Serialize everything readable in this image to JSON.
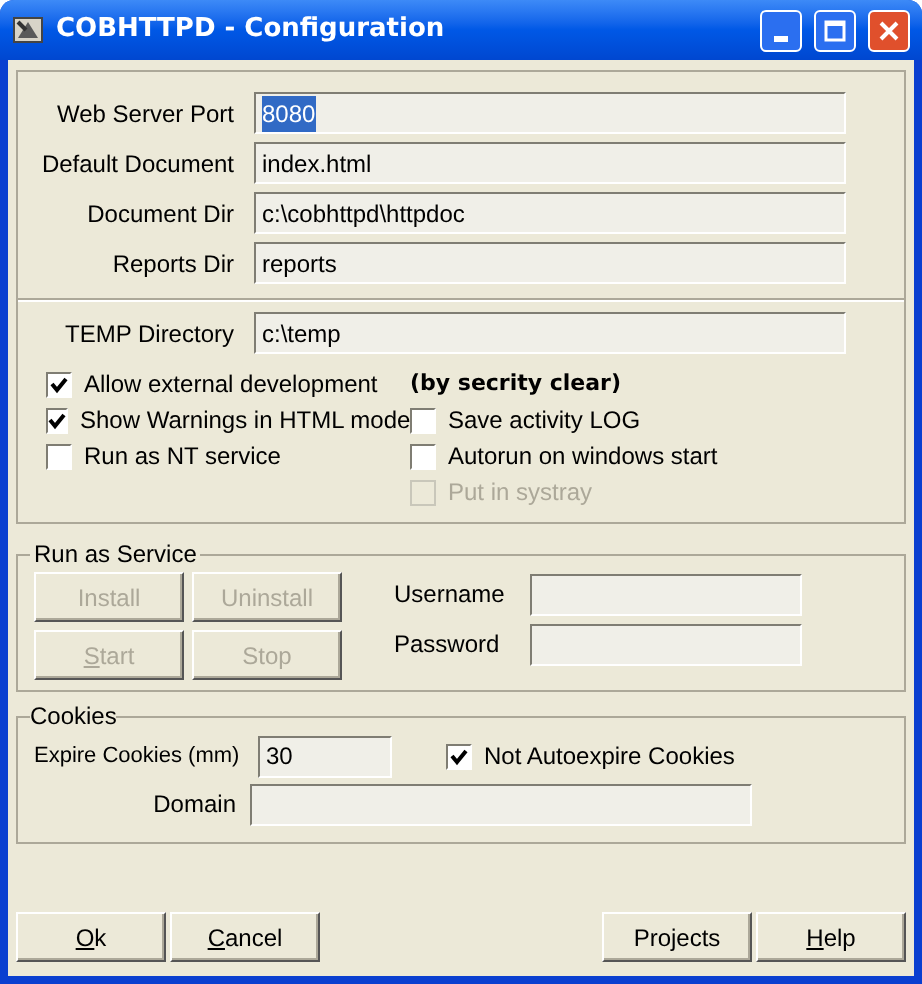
{
  "window": {
    "title": "COBHTTPD - Configuration"
  },
  "fields": [
    {
      "label": "Web Server Port",
      "value": "8080",
      "highlighted": true
    },
    {
      "label": "Default Document",
      "value": "index.html",
      "highlighted": false
    },
    {
      "label": "Document Dir",
      "value": "c:\\cobhttpd\\httpdoc",
      "highlighted": false
    },
    {
      "label": "Reports Dir",
      "value": "reports",
      "highlighted": false
    }
  ],
  "temp": {
    "label": "TEMP Directory",
    "value": "c:\\temp"
  },
  "options_left": [
    {
      "label": "Allow external  development",
      "checked": true,
      "disabled": false
    },
    {
      "label": "Show Warnings in HTML mode",
      "checked": true,
      "disabled": false
    },
    {
      "label": "Run as NT service",
      "checked": false,
      "disabled": false
    }
  ],
  "options_right_heading": "(by secrity clear)",
  "options_right": [
    {
      "label": "Save activity LOG",
      "checked": false,
      "disabled": false
    },
    {
      "label": "Autorun on windows start",
      "checked": false,
      "disabled": false
    },
    {
      "label": "Put in systray",
      "checked": false,
      "disabled": true
    }
  ],
  "service": {
    "title": "Run as Service",
    "buttons": [
      {
        "label": "Install",
        "disabled": true,
        "underline_first": false
      },
      {
        "label": "Uninstall",
        "disabled": true,
        "underline_first": false
      },
      {
        "label": "Start",
        "disabled": true,
        "underline_first": true
      },
      {
        "label": "Stop",
        "disabled": true,
        "underline_first": false
      }
    ],
    "fields": [
      {
        "label": "Username"
      },
      {
        "label": "Password"
      }
    ]
  },
  "cookies": {
    "title": "Cookies",
    "expire": {
      "label": "Expire Cookies (mm)",
      "value": "30"
    },
    "not_autoexpire": {
      "label": "Not Autoexpire Cookies",
      "checked": true
    },
    "domain": {
      "label": "Domain"
    }
  },
  "footer_left": [
    {
      "label": "Ok",
      "underline_first": true
    },
    {
      "label": "Cancel",
      "underline_first": true
    }
  ],
  "footer_right": [
    {
      "label": "Projects",
      "underline_first": false
    },
    {
      "label": "Help",
      "underline_first": true
    }
  ]
}
